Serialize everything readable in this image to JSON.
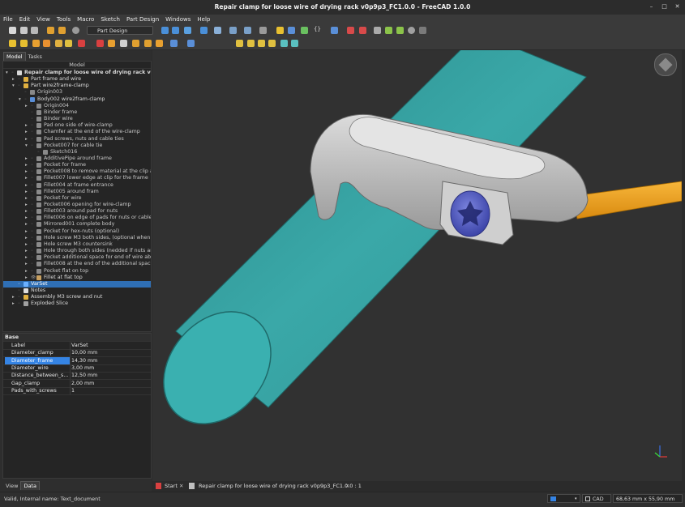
{
  "window": {
    "title": "Repair clamp for loose wire of drying rack v0p9p3_FC1.0.0 - FreeCAD 1.0.0"
  },
  "menu": [
    "File",
    "Edit",
    "View",
    "Tools",
    "Macro",
    "Sketch",
    "Part Design",
    "Windows",
    "Help"
  ],
  "toolbar": {
    "workbench": "Part Design",
    "braces": "{}"
  },
  "panel": {
    "tabs": [
      "Model",
      "Tasks"
    ],
    "header": "Model",
    "bottom_tabs": [
      "View",
      "Data"
    ]
  },
  "tree": [
    {
      "label": "Repair clamp for loose wire of drying rack v0p9p3_...",
      "level": 0,
      "arrow": "▾",
      "bold": true,
      "icon": "document-icon",
      "color": "#d8d8d8"
    },
    {
      "label": "Part frame and wire",
      "level": 1,
      "arrow": "▸",
      "icon": "part-icon",
      "color": "#e0b040"
    },
    {
      "label": "Part wire2frame-clamp",
      "level": 1,
      "arrow": "▾",
      "icon": "part-icon",
      "color": "#e0b040"
    },
    {
      "label": "Origin003",
      "level": 2,
      "arrow": "",
      "icon": "origin-icon",
      "color": "#888888",
      "dim": true
    },
    {
      "label": "Body002 wire2fram-clamp",
      "level": 2,
      "arrow": "▾",
      "icon": "body-icon",
      "color": "#5a8fd8"
    },
    {
      "label": "Origin004",
      "level": 3,
      "arrow": "▸",
      "icon": "origin-icon",
      "color": "#888888",
      "dim": true
    },
    {
      "label": "Binder frame",
      "level": 3,
      "arrow": "",
      "icon": "binder-icon",
      "color": "#8a8a8a",
      "dim": true
    },
    {
      "label": "Binder wire",
      "level": 3,
      "arrow": "",
      "icon": "binder-icon",
      "color": "#8a8a8a",
      "dim": true
    },
    {
      "label": "Pad one side of wire-clamp",
      "level": 3,
      "arrow": "▸",
      "icon": "pad-icon",
      "color": "#8a8a8a",
      "dim": true
    },
    {
      "label": "Chamfer at the end of the wire-clamp",
      "level": 3,
      "arrow": "▸",
      "icon": "chamfer-icon",
      "color": "#8a8a8a",
      "dim": true
    },
    {
      "label": "Pad screws, nuts and cable ties",
      "level": 3,
      "arrow": "▸",
      "icon": "pad-icon",
      "color": "#8a8a8a",
      "dim": true
    },
    {
      "label": "Pocket007 for cable tie",
      "level": 3,
      "arrow": "▾",
      "icon": "pocket-icon",
      "color": "#8a8a8a",
      "dim": true
    },
    {
      "label": "Sketch016",
      "level": 4,
      "arrow": "",
      "icon": "sketch-icon",
      "color": "#8a8a8a",
      "dim": true
    },
    {
      "label": "AdditivePipe around frame",
      "level": 3,
      "arrow": "▸",
      "icon": "pipe-icon",
      "color": "#8a8a8a",
      "dim": true
    },
    {
      "label": "Pocket for frame",
      "level": 3,
      "arrow": "▸",
      "icon": "pocket-icon",
      "color": "#8a8a8a",
      "dim": true
    },
    {
      "label": "Pocket008 to remove material at the clip a...",
      "level": 3,
      "arrow": "▸",
      "icon": "pocket-icon",
      "color": "#8a8a8a",
      "dim": true
    },
    {
      "label": "Fillet007 lower edge at clip for the frame",
      "level": 3,
      "arrow": "▸",
      "icon": "fillet-icon",
      "color": "#8a8a8a",
      "dim": true
    },
    {
      "label": "Fillet004 at frame entrance",
      "level": 3,
      "arrow": "▸",
      "icon": "fillet-icon",
      "color": "#8a8a8a",
      "dim": true
    },
    {
      "label": "Fillet005 around fram",
      "level": 3,
      "arrow": "▸",
      "icon": "fillet-icon",
      "color": "#8a8a8a",
      "dim": true
    },
    {
      "label": "Pocket for wire",
      "level": 3,
      "arrow": "▸",
      "icon": "pocket-icon",
      "color": "#8a8a8a",
      "dim": true
    },
    {
      "label": "Pocket006 opening for wire-clamp",
      "level": 3,
      "arrow": "▸",
      "icon": "pocket-icon",
      "color": "#8a8a8a",
      "dim": true
    },
    {
      "label": "Fillet003 around pad for nuts",
      "level": 3,
      "arrow": "▸",
      "icon": "fillet-icon",
      "color": "#8a8a8a",
      "dim": true
    },
    {
      "label": "Fillet006 on edge of pads for nuts or cable...",
      "level": 3,
      "arrow": "▸",
      "icon": "fillet-icon",
      "color": "#8a8a8a",
      "dim": true
    },
    {
      "label": "Mirrored001 complete body",
      "level": 3,
      "arrow": "▸",
      "icon": "mirror-icon",
      "color": "#8a8a8a",
      "dim": true
    },
    {
      "label": "Pocket for hex-nuts (optional)",
      "level": 3,
      "arrow": "▸",
      "icon": "pocket-icon",
      "color": "#8a8a8a",
      "dim": true
    },
    {
      "label": "Hole screw M3 both sides, (optional when ...",
      "level": 3,
      "arrow": "▸",
      "icon": "hole-icon",
      "color": "#8a8a8a",
      "dim": true
    },
    {
      "label": "Hole screw M3 countersink",
      "level": 3,
      "arrow": "▸",
      "icon": "hole-icon",
      "color": "#8a8a8a",
      "dim": true
    },
    {
      "label": "Hole through both sides (nedded if nuts ar...",
      "level": 3,
      "arrow": "▸",
      "icon": "hole-icon",
      "color": "#8a8a8a",
      "dim": true
    },
    {
      "label": "Pocket additional space for end of wire ab...",
      "level": 3,
      "arrow": "▸",
      "icon": "pocket-icon",
      "color": "#8a8a8a",
      "dim": true
    },
    {
      "label": "Fillet008 at the end of the additional space",
      "level": 3,
      "arrow": "▸",
      "icon": "fillet-icon",
      "color": "#8a8a8a",
      "dim": true
    },
    {
      "label": "Pocket flat on top",
      "level": 3,
      "arrow": "▸",
      "icon": "pocket-icon",
      "color": "#8a8a8a",
      "dim": true
    },
    {
      "label": "Fillet at flat top",
      "level": 3,
      "arrow": "▸",
      "icon": "fillet-icon",
      "color": "#c8a060",
      "eye": true
    },
    {
      "label": "VarSet",
      "level": 1,
      "arrow": "",
      "icon": "varset-icon",
      "color": "#6ab0ff",
      "selected": true
    },
    {
      "label": "Notes",
      "level": 1,
      "arrow": "",
      "icon": "notes-icon",
      "color": "#dddddd"
    },
    {
      "label": "Assembly M3 screw and nut",
      "level": 1,
      "arrow": "▸",
      "icon": "assembly-icon",
      "color": "#e0b040"
    },
    {
      "label": "Exploded Slice",
      "level": 1,
      "arrow": "▸",
      "icon": "folder-icon",
      "color": "#a0a0a0"
    }
  ],
  "properties": {
    "group": "Base",
    "rows": [
      {
        "key": "Label",
        "value": "VarSet"
      },
      {
        "key": "Diameter_clamp",
        "value": "10,00 mm"
      },
      {
        "key": "Diameter_frame",
        "value": "14,30 mm",
        "selected": true
      },
      {
        "key": "Diameter_wire",
        "value": "3,00 mm"
      },
      {
        "key": "Distance_between_s...",
        "value": "12,50 mm"
      },
      {
        "key": "Gap_clamp",
        "value": "2,00 mm"
      },
      {
        "key": "Pads_with_screws",
        "value": "1"
      }
    ]
  },
  "doc_tabs": [
    {
      "label": "Start"
    },
    {
      "label": "Repair clamp for loose wire of drying rack v0p9p3_FC1.0.0 : 1"
    }
  ],
  "status": {
    "message": "Valid, Internal name: Text_document",
    "nav_style": "CAD",
    "dimensions": "68,63 mm x 55,90 mm"
  },
  "colors": {
    "rod": "#3ba6a6",
    "wire": "#f0a21a",
    "clamp": "#c9c9c9",
    "screw": "#5a63c8",
    "selection": "#3584e4"
  }
}
